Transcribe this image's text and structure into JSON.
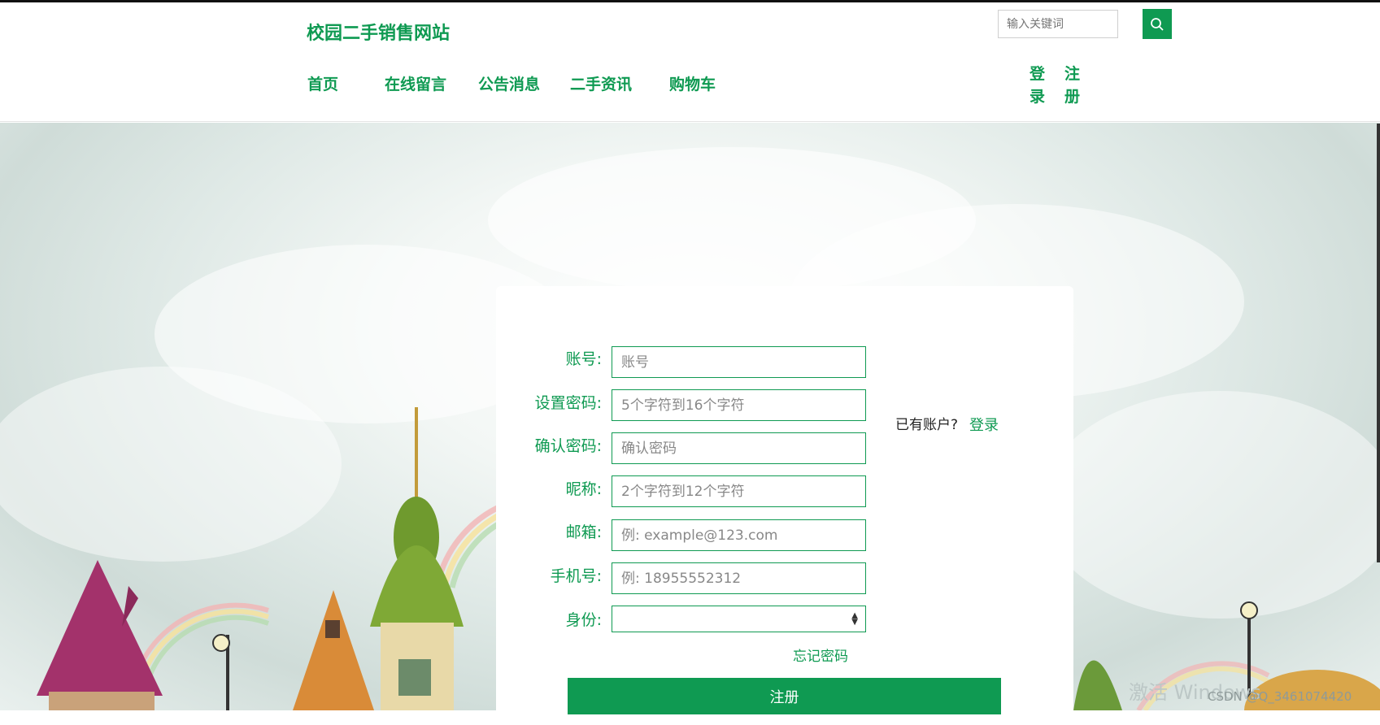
{
  "header": {
    "site_title": "校园二手销售网站",
    "search_placeholder": "输入关键词",
    "nav": [
      "首页",
      "在线留言",
      "公告消息",
      "二手资讯",
      "购物车"
    ],
    "login_label": "登录",
    "register_label": "注册"
  },
  "form": {
    "fields": [
      {
        "label": "账号:",
        "placeholder": "账号"
      },
      {
        "label": "设置密码:",
        "placeholder": "5个字符到16个字符"
      },
      {
        "label": "确认密码:",
        "placeholder": "确认密码"
      },
      {
        "label": "昵称:",
        "placeholder": "2个字符到12个字符"
      },
      {
        "label": "邮箱:",
        "placeholder": "例: example@123.com"
      },
      {
        "label": "手机号:",
        "placeholder": "例: 18955552312"
      }
    ],
    "identity_label": "身份:",
    "identity_value": "",
    "forgot_password": "忘记密码",
    "have_account": "已有账户?",
    "login_link": "登录",
    "submit_label": "注册"
  },
  "watermark": {
    "csdn": "CSDN @Q_3461074420",
    "windows": "激活 Windows"
  },
  "colors": {
    "accent": "#0f9a52"
  },
  "icons": {
    "search": "search-icon"
  }
}
